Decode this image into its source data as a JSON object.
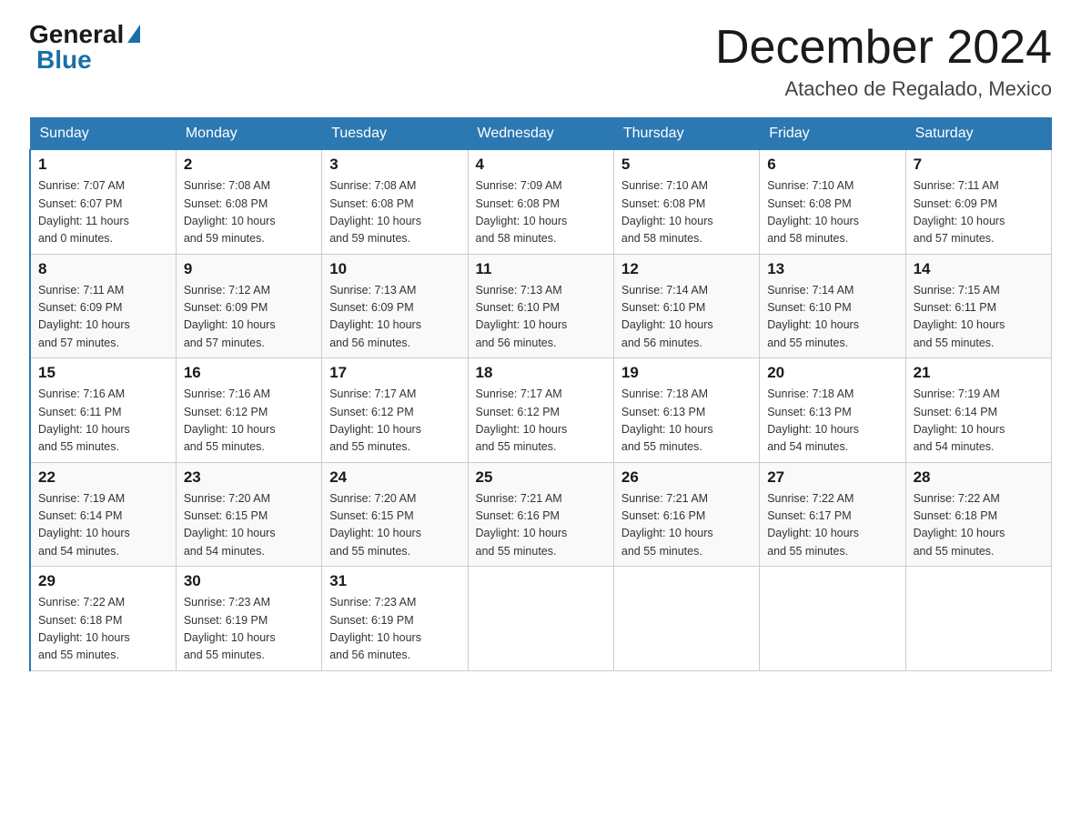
{
  "logo": {
    "general": "General",
    "triangle": "",
    "blue": "Blue"
  },
  "title": "December 2024",
  "subtitle": "Atacheo de Regalado, Mexico",
  "weekdays": [
    "Sunday",
    "Monday",
    "Tuesday",
    "Wednesday",
    "Thursday",
    "Friday",
    "Saturday"
  ],
  "weeks": [
    [
      {
        "day": "1",
        "info": "Sunrise: 7:07 AM\nSunset: 6:07 PM\nDaylight: 11 hours\nand 0 minutes."
      },
      {
        "day": "2",
        "info": "Sunrise: 7:08 AM\nSunset: 6:08 PM\nDaylight: 10 hours\nand 59 minutes."
      },
      {
        "day": "3",
        "info": "Sunrise: 7:08 AM\nSunset: 6:08 PM\nDaylight: 10 hours\nand 59 minutes."
      },
      {
        "day": "4",
        "info": "Sunrise: 7:09 AM\nSunset: 6:08 PM\nDaylight: 10 hours\nand 58 minutes."
      },
      {
        "day": "5",
        "info": "Sunrise: 7:10 AM\nSunset: 6:08 PM\nDaylight: 10 hours\nand 58 minutes."
      },
      {
        "day": "6",
        "info": "Sunrise: 7:10 AM\nSunset: 6:08 PM\nDaylight: 10 hours\nand 58 minutes."
      },
      {
        "day": "7",
        "info": "Sunrise: 7:11 AM\nSunset: 6:09 PM\nDaylight: 10 hours\nand 57 minutes."
      }
    ],
    [
      {
        "day": "8",
        "info": "Sunrise: 7:11 AM\nSunset: 6:09 PM\nDaylight: 10 hours\nand 57 minutes."
      },
      {
        "day": "9",
        "info": "Sunrise: 7:12 AM\nSunset: 6:09 PM\nDaylight: 10 hours\nand 57 minutes."
      },
      {
        "day": "10",
        "info": "Sunrise: 7:13 AM\nSunset: 6:09 PM\nDaylight: 10 hours\nand 56 minutes."
      },
      {
        "day": "11",
        "info": "Sunrise: 7:13 AM\nSunset: 6:10 PM\nDaylight: 10 hours\nand 56 minutes."
      },
      {
        "day": "12",
        "info": "Sunrise: 7:14 AM\nSunset: 6:10 PM\nDaylight: 10 hours\nand 56 minutes."
      },
      {
        "day": "13",
        "info": "Sunrise: 7:14 AM\nSunset: 6:10 PM\nDaylight: 10 hours\nand 55 minutes."
      },
      {
        "day": "14",
        "info": "Sunrise: 7:15 AM\nSunset: 6:11 PM\nDaylight: 10 hours\nand 55 minutes."
      }
    ],
    [
      {
        "day": "15",
        "info": "Sunrise: 7:16 AM\nSunset: 6:11 PM\nDaylight: 10 hours\nand 55 minutes."
      },
      {
        "day": "16",
        "info": "Sunrise: 7:16 AM\nSunset: 6:12 PM\nDaylight: 10 hours\nand 55 minutes."
      },
      {
        "day": "17",
        "info": "Sunrise: 7:17 AM\nSunset: 6:12 PM\nDaylight: 10 hours\nand 55 minutes."
      },
      {
        "day": "18",
        "info": "Sunrise: 7:17 AM\nSunset: 6:12 PM\nDaylight: 10 hours\nand 55 minutes."
      },
      {
        "day": "19",
        "info": "Sunrise: 7:18 AM\nSunset: 6:13 PM\nDaylight: 10 hours\nand 55 minutes."
      },
      {
        "day": "20",
        "info": "Sunrise: 7:18 AM\nSunset: 6:13 PM\nDaylight: 10 hours\nand 54 minutes."
      },
      {
        "day": "21",
        "info": "Sunrise: 7:19 AM\nSunset: 6:14 PM\nDaylight: 10 hours\nand 54 minutes."
      }
    ],
    [
      {
        "day": "22",
        "info": "Sunrise: 7:19 AM\nSunset: 6:14 PM\nDaylight: 10 hours\nand 54 minutes."
      },
      {
        "day": "23",
        "info": "Sunrise: 7:20 AM\nSunset: 6:15 PM\nDaylight: 10 hours\nand 54 minutes."
      },
      {
        "day": "24",
        "info": "Sunrise: 7:20 AM\nSunset: 6:15 PM\nDaylight: 10 hours\nand 55 minutes."
      },
      {
        "day": "25",
        "info": "Sunrise: 7:21 AM\nSunset: 6:16 PM\nDaylight: 10 hours\nand 55 minutes."
      },
      {
        "day": "26",
        "info": "Sunrise: 7:21 AM\nSunset: 6:16 PM\nDaylight: 10 hours\nand 55 minutes."
      },
      {
        "day": "27",
        "info": "Sunrise: 7:22 AM\nSunset: 6:17 PM\nDaylight: 10 hours\nand 55 minutes."
      },
      {
        "day": "28",
        "info": "Sunrise: 7:22 AM\nSunset: 6:18 PM\nDaylight: 10 hours\nand 55 minutes."
      }
    ],
    [
      {
        "day": "29",
        "info": "Sunrise: 7:22 AM\nSunset: 6:18 PM\nDaylight: 10 hours\nand 55 minutes."
      },
      {
        "day": "30",
        "info": "Sunrise: 7:23 AM\nSunset: 6:19 PM\nDaylight: 10 hours\nand 55 minutes."
      },
      {
        "day": "31",
        "info": "Sunrise: 7:23 AM\nSunset: 6:19 PM\nDaylight: 10 hours\nand 56 minutes."
      },
      {
        "day": "",
        "info": ""
      },
      {
        "day": "",
        "info": ""
      },
      {
        "day": "",
        "info": ""
      },
      {
        "day": "",
        "info": ""
      }
    ]
  ]
}
